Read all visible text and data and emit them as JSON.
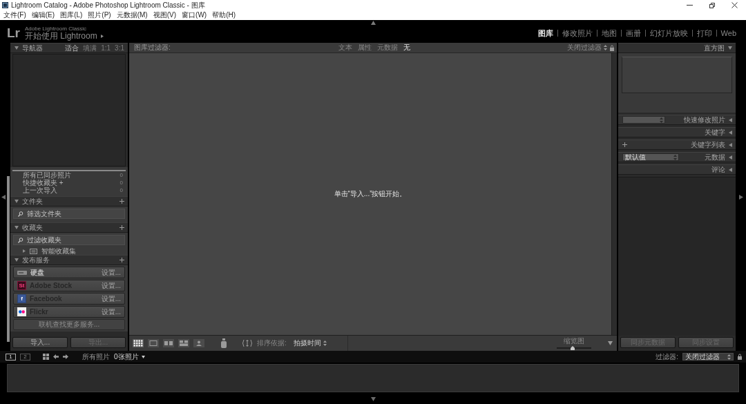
{
  "window": {
    "title": "Lightroom Catalog - Adobe Photoshop Lightroom Classic - 图库"
  },
  "menu_bar": [
    "文件(F)",
    "编辑(E)",
    "图库(L)",
    "照片(P)",
    "元数据(M)",
    "视图(V)",
    "窗口(W)",
    "帮助(H)"
  ],
  "identity_plate": {
    "logo": "Lr",
    "product": "Adobe Lightroom Classic",
    "title": "开始使用 Lightroom"
  },
  "modules": [
    {
      "label": "图库",
      "selected": true
    },
    {
      "label": "修改照片",
      "selected": false
    },
    {
      "label": "地图",
      "selected": false
    },
    {
      "label": "画册",
      "selected": false
    },
    {
      "label": "幻灯片放映",
      "selected": false
    },
    {
      "label": "打印",
      "selected": false
    },
    {
      "label": "Web",
      "selected": false
    }
  ],
  "left_panel": {
    "navigator": {
      "title": "导航器",
      "expanded": true,
      "zoom_options": [
        {
          "label": "适合",
          "selected": true
        },
        {
          "label": "填满",
          "selected": false
        },
        {
          "label": "1:1",
          "selected": false
        },
        {
          "label": "3:1",
          "selected": false
        }
      ]
    },
    "catalog_items": [
      {
        "label": "所有已同步照片",
        "count": "0"
      },
      {
        "label": "快捷收藏夹 +",
        "count": "0"
      },
      {
        "label": "上一次导入",
        "count": "0"
      }
    ],
    "folders": {
      "title": "文件夹",
      "expanded": true,
      "filter": {
        "placeholder": "筛选文件夹"
      }
    },
    "collections": {
      "title": "收藏夹",
      "expanded": true,
      "filter": {
        "placeholder": "过滤收藏夹"
      },
      "items": [
        {
          "label": "智能收藏集",
          "expanded": false
        }
      ]
    },
    "publish_services": {
      "title": "发布服务",
      "expanded": true,
      "services": [
        {
          "kind": "drive",
          "name": "硬盘",
          "action": "设置...",
          "disabled": false
        },
        {
          "kind": "stock",
          "logo": "St",
          "name": "Adobe Stock",
          "action": "设置...",
          "disabled": true
        },
        {
          "kind": "facebook",
          "logo": "f",
          "name": "Facebook",
          "action": "设置...",
          "disabled": true
        },
        {
          "kind": "flickr",
          "name": "Flickr",
          "action": "设置...",
          "disabled": true
        }
      ],
      "find_more": "联机查找更多服务..."
    },
    "buttons": [
      {
        "label": "导入...",
        "disabled": false
      },
      {
        "label": "导出...",
        "disabled": true
      }
    ]
  },
  "library_filter": {
    "label": "图库过滤器:",
    "options": [
      {
        "label": "文本",
        "selected": false
      },
      {
        "label": "属性",
        "selected": false
      },
      {
        "label": "元数据",
        "selected": false
      },
      {
        "label": "无",
        "selected": true
      }
    ],
    "preset": "关闭过滤器"
  },
  "grid": {
    "message": "单击“导入...”按钮开始。"
  },
  "toolbar": {
    "view_modes": [
      {
        "kind": "grid",
        "selected": true
      },
      {
        "kind": "loupe",
        "selected": false
      },
      {
        "kind": "compare",
        "selected": false
      },
      {
        "kind": "survey",
        "selected": false
      },
      {
        "kind": "people",
        "selected": false
      }
    ],
    "sort": {
      "label": "排序依据:",
      "value": "拍摄时间"
    },
    "thumbnails": {
      "label": "缩览图",
      "level": 0.45
    }
  },
  "right_panel": {
    "histogram": {
      "title": "直方图",
      "expanded": true
    },
    "sections": [
      {
        "kind": "quick_develop",
        "title": "快速修改照片",
        "expanded": false
      },
      {
        "kind": "plain",
        "title": "关键字",
        "expanded": false
      },
      {
        "kind": "add",
        "title": "关键字列表",
        "expanded": false
      },
      {
        "kind": "preset",
        "preset": "默认值",
        "title": "元数据",
        "expanded": false
      },
      {
        "kind": "plain",
        "title": "评论",
        "expanded": false
      }
    ],
    "buttons": [
      {
        "label": "同步元数据",
        "disabled": true
      },
      {
        "label": "同步设置",
        "disabled": true
      }
    ]
  },
  "filmstrip": {
    "pages": [
      {
        "label": "1",
        "selected": true
      },
      {
        "label": "2",
        "selected": false
      }
    ],
    "source": "所有照片",
    "count": "0张照片",
    "filter": {
      "label": "过滤器:",
      "value": "关闭过滤器"
    }
  }
}
